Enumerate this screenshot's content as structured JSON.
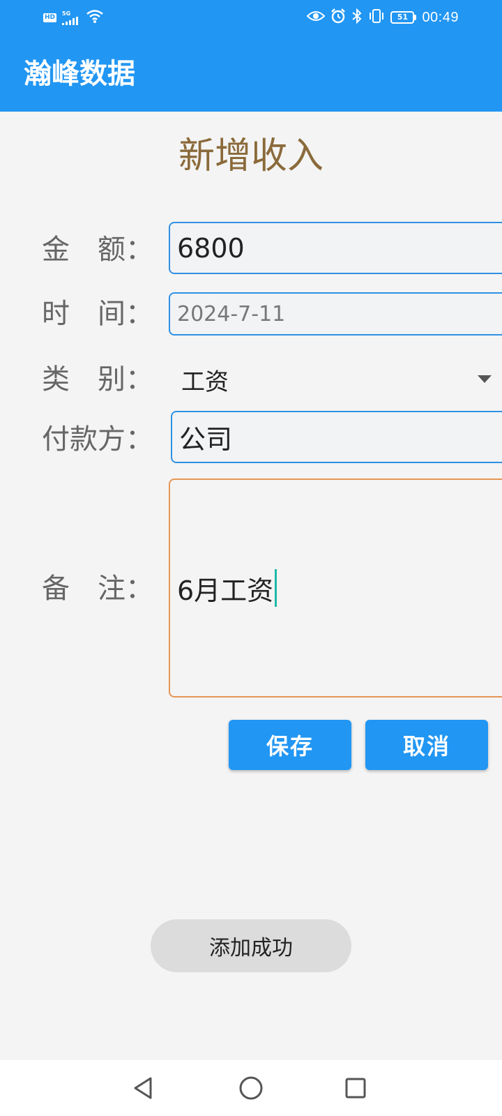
{
  "status_bar": {
    "hd_badge": "HD",
    "network": "5G",
    "battery": "51",
    "time": "00:49",
    "icons": [
      "hd-icon",
      "signal-icon",
      "wifi-icon",
      "eye-icon",
      "alarm-icon",
      "bluetooth-icon",
      "vibrate-icon",
      "battery-icon"
    ]
  },
  "app_bar": {
    "title": "瀚峰数据"
  },
  "page": {
    "title": "新增收入"
  },
  "form": {
    "amount": {
      "label": "金　额：",
      "value": "6800"
    },
    "time": {
      "label": "时　间：",
      "value": "2024-7-11"
    },
    "category": {
      "label": "类　别：",
      "value": "工资"
    },
    "payer": {
      "label": "付款方：",
      "value": "公司"
    },
    "note": {
      "label": "备　注：",
      "value": "6月工资"
    }
  },
  "buttons": {
    "save": "保存",
    "cancel": "取消"
  },
  "toast": {
    "message": "添加成功"
  },
  "nav_bar": {
    "icons": [
      "back-icon",
      "home-icon",
      "recent-apps-icon"
    ]
  },
  "colors": {
    "primary": "#2196f3",
    "title_text": "#8a6a3a",
    "field_border": "#2f90e3",
    "note_border_focused": "#e59654",
    "caret": "#1fb8a8",
    "background": "#f4f4f4"
  }
}
